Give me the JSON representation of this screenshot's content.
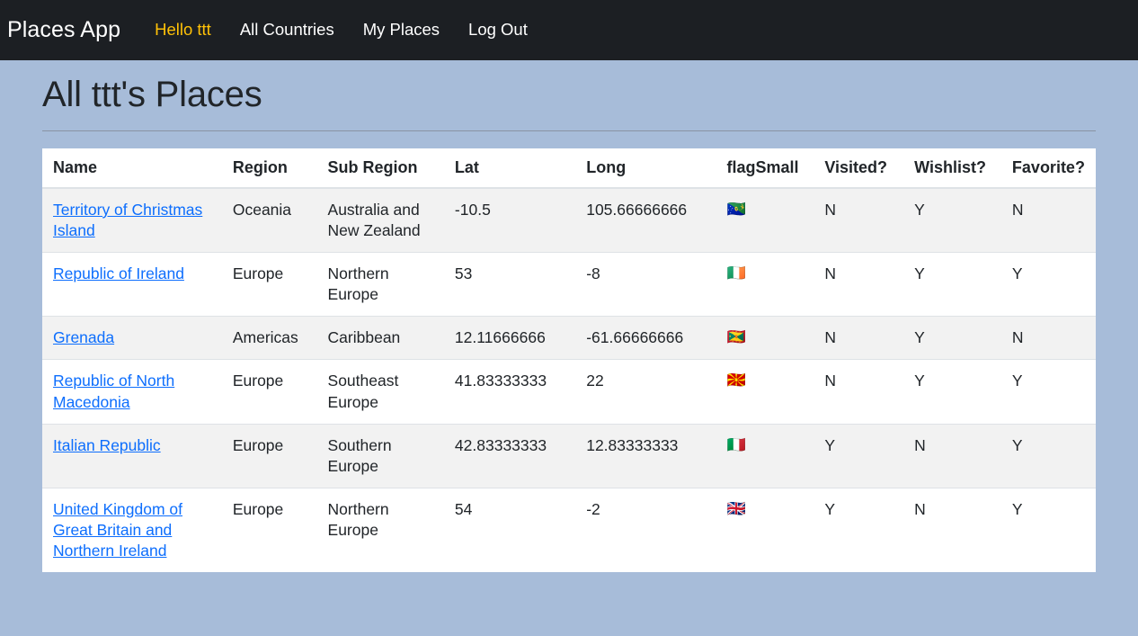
{
  "navbar": {
    "brand": "Places App",
    "links": [
      {
        "label": "Hello ttt",
        "style": "user"
      },
      {
        "label": "All Countries",
        "style": "normal"
      },
      {
        "label": "My Places",
        "style": "normal"
      },
      {
        "label": "Log Out",
        "style": "normal"
      }
    ],
    "accent_color": "#ffc107",
    "background_color": "#1c1f23"
  },
  "page": {
    "title": "All ttt's Places",
    "background_color": "#a7bcd9"
  },
  "table": {
    "columns": [
      "Name",
      "Region",
      "Sub Region",
      "Lat",
      "Long",
      "flagSmall",
      "Visited?",
      "Wishlist?",
      "Favorite?"
    ],
    "rows": [
      {
        "name": "Territory of Christmas Island",
        "region": "Oceania",
        "sub_region": "Australia and New Zealand",
        "lat": "-10.5",
        "long": "105.66666666",
        "flag": "🇨🇽",
        "visited": "N",
        "wishlist": "Y",
        "favorite": "N"
      },
      {
        "name": "Republic of Ireland",
        "region": "Europe",
        "sub_region": "Northern Europe",
        "lat": "53",
        "long": "-8",
        "flag": "🇮🇪",
        "visited": "N",
        "wishlist": "Y",
        "favorite": "Y"
      },
      {
        "name": "Grenada",
        "region": "Americas",
        "sub_region": "Caribbean",
        "lat": "12.11666666",
        "long": "-61.66666666",
        "flag": "🇬🇩",
        "visited": "N",
        "wishlist": "Y",
        "favorite": "N"
      },
      {
        "name": "Republic of North Macedonia",
        "region": "Europe",
        "sub_region": "Southeast Europe",
        "lat": "41.83333333",
        "long": "22",
        "flag": "🇲🇰",
        "visited": "N",
        "wishlist": "Y",
        "favorite": "Y"
      },
      {
        "name": "Italian Republic",
        "region": "Europe",
        "sub_region": "Southern Europe",
        "lat": "42.83333333",
        "long": "12.83333333",
        "flag": "🇮🇹",
        "visited": "Y",
        "wishlist": "N",
        "favorite": "Y"
      },
      {
        "name": "United Kingdom of Great Britain and Northern Ireland",
        "region": "Europe",
        "sub_region": "Northern Europe",
        "lat": "54",
        "long": "-2",
        "flag": "🇬🇧",
        "visited": "Y",
        "wishlist": "N",
        "favorite": "Y"
      }
    ]
  }
}
